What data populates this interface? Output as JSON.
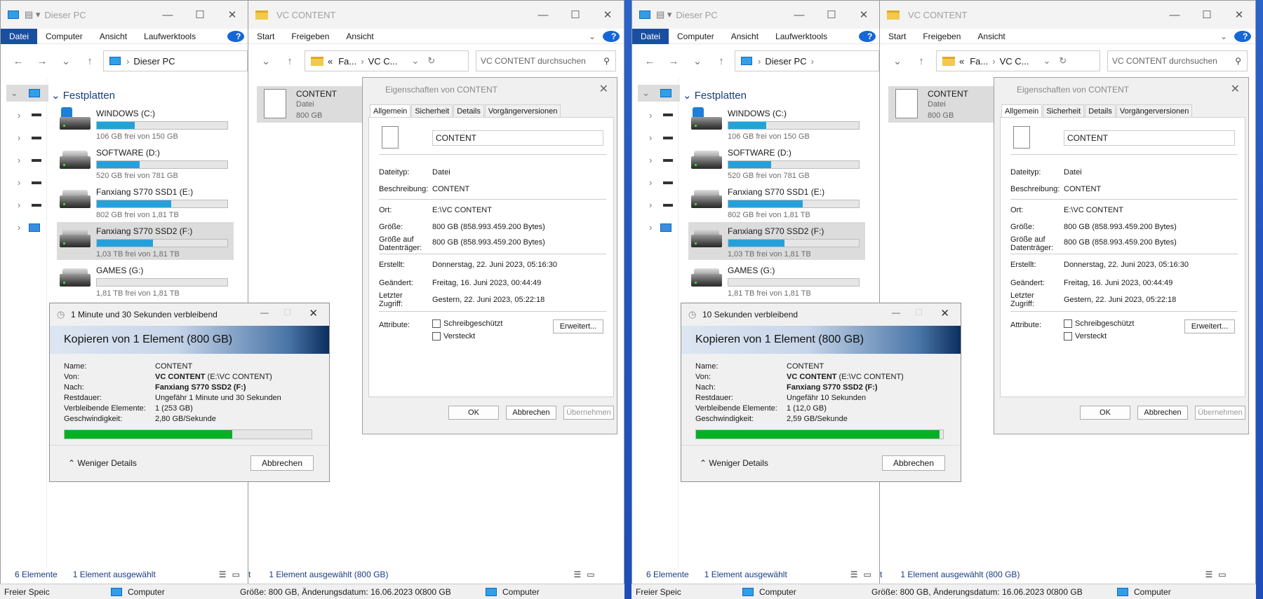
{
  "explorer_left": {
    "title": "Dieser PC",
    "ribbon": [
      "Datei",
      "Computer",
      "Ansicht",
      "Laufwerktools"
    ],
    "address": "Dieser PC",
    "section": "Festplatten",
    "drives": [
      {
        "name": "WINDOWS (C:)",
        "free": "106 GB frei von 150 GB",
        "used_fraction": 0.29
      },
      {
        "name": "SOFTWARE (D:)",
        "free": "520 GB frei von 781 GB",
        "used_fraction": 0.33
      },
      {
        "name": "Fanxiang S770 SSD1 (E:)",
        "free": "802 GB frei von 1,81 TB",
        "used_fraction": 0.57
      },
      {
        "name": "Fanxiang S770 SSD2 (F:)",
        "free": "1,03 TB frei von 1,81 TB",
        "used_fraction": 0.43
      },
      {
        "name": "GAMES (G:)",
        "free": "1,81 TB frei von 1,81 TB",
        "used_fraction": 0.0
      }
    ],
    "status_count": "6 Elemente",
    "status_selected": "1 Element ausgewählt",
    "taskbar_left": "Freier Speic",
    "taskbar_computer": "Computer"
  },
  "explorer_right": {
    "title": "VC CONTENT",
    "ribbon": [
      "Start",
      "Freigeben",
      "Ansicht"
    ],
    "address_parts": [
      "«",
      "Fa...",
      "VC C..."
    ],
    "search_placeholder": "VC CONTENT durchsuchen",
    "file": {
      "name": "CONTENT",
      "type": "Datei",
      "size": "800 GB"
    },
    "status_selected": "1 Element ausgewählt (800 GB)",
    "taskbar_info": "Größe: 800 GB, Änderungsdatum: 16.06.2023 00:",
    "taskbar_size": "800 GB",
    "taskbar_computer": "Computer"
  },
  "properties": {
    "title": "Eigenschaften von CONTENT",
    "tabs": [
      "Allgemein",
      "Sicherheit",
      "Details",
      "Vorgängerversionen"
    ],
    "name": "CONTENT",
    "rows": [
      {
        "label": "Dateityp:",
        "value": "Datei"
      },
      {
        "label": "Beschreibung:",
        "value": "CONTENT"
      },
      {
        "label": "Ort:",
        "value": "E:\\VC CONTENT"
      },
      {
        "label": "Größe:",
        "value": "800 GB (858.993.459.200 Bytes)"
      },
      {
        "label": "Größe auf Datenträger:",
        "value": "800 GB (858.993.459.200 Bytes)"
      },
      {
        "label": "Erstellt:",
        "value": "Donnerstag, 22. Juni 2023, 05:16:30"
      },
      {
        "label": "Geändert:",
        "value": "Freitag, 16. Juni 2023, 00:44:49"
      },
      {
        "label": "Letzter Zugriff:",
        "value": "Gestern, 22. Juni 2023, 05:22:18"
      }
    ],
    "attr_label": "Attribute:",
    "readonly": "Schreibgeschützt",
    "hidden": "Versteckt",
    "advanced": "Erweitert...",
    "ok": "OK",
    "cancel": "Abbrechen",
    "apply": "Übernehmen"
  },
  "copy_left": {
    "title": "1 Minute und 30 Sekunden verbleibend",
    "heading": "Kopieren von 1 Element (800 GB)",
    "labels": [
      "Name:",
      "Von:",
      "Nach:",
      "Restdauer:",
      "Verbleibende Elemente:",
      "Geschwindigkeit:"
    ],
    "name": "CONTENT",
    "from_bold": "VC CONTENT",
    "from_rest": " (E:\\VC CONTENT)",
    "to": "Fanxiang S770 SSD2 (F:)",
    "remaining": "Ungefähr 1 Minute und 30 Sekunden",
    "items": "1 (253 GB)",
    "speed": "2,80 GB/Sekunde",
    "progress": 0.68,
    "less": "Weniger Details",
    "cancel": "Abbrechen"
  },
  "copy_right": {
    "title": "10 Sekunden verbleibend",
    "heading": "Kopieren von 1 Element (800 GB)",
    "labels": [
      "Name:",
      "Von:",
      "Nach:",
      "Restdauer:",
      "Verbleibende Elemente:",
      "Geschwindigkeit:"
    ],
    "name": "CONTENT",
    "from_bold": "VC CONTENT",
    "from_rest": " (E:\\VC CONTENT)",
    "to": "Fanxiang S770 SSD2 (F:)",
    "remaining": "Ungefähr 10 Sekunden",
    "items": "1 (12,0 GB)",
    "speed": "2,59 GB/Sekunde",
    "progress": 0.985,
    "less": "Weniger Details",
    "cancel": "Abbrechen"
  },
  "colors": {
    "drive_bar": "#26a0da",
    "copy_progress": "#06b025",
    "ribbon_active": "#1a4fa0"
  }
}
